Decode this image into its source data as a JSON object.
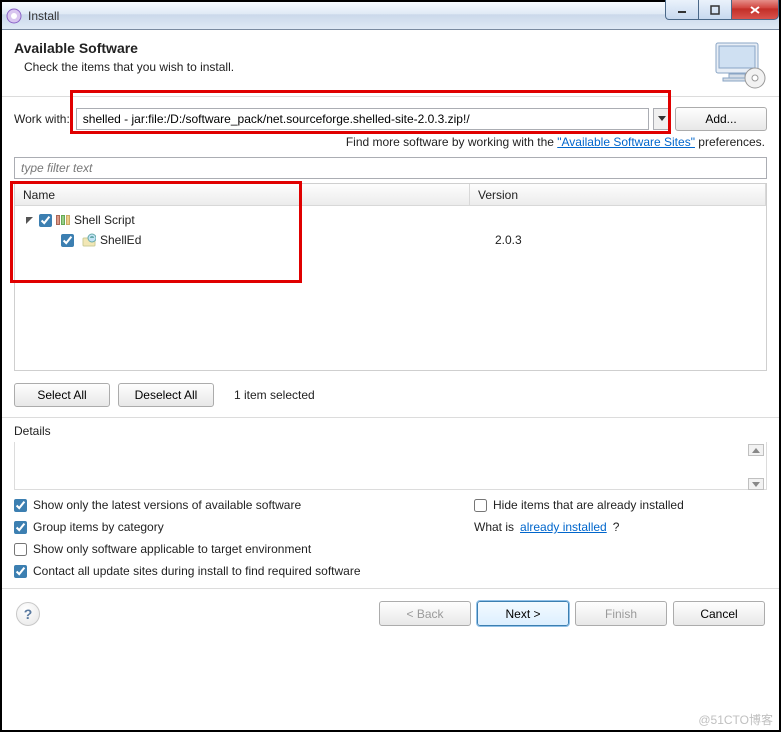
{
  "window": {
    "title": "Install"
  },
  "header": {
    "title": "Available Software",
    "subtitle": "Check the items that you wish to install."
  },
  "workwith": {
    "label": "Work with:",
    "value": "shelled - jar:file:/D:/software_pack/net.sourceforge.shelled-site-2.0.3.zip!/",
    "add_label": "Add...",
    "findmore_prefix": "Find more software by working with the ",
    "findmore_link": "\"Available Software Sites\"",
    "findmore_suffix": " preferences."
  },
  "filter": {
    "placeholder": "type filter text"
  },
  "tree": {
    "columns": {
      "name": "Name",
      "version": "Version"
    },
    "root": {
      "label": "Shell Script",
      "checked": true,
      "expanded": true
    },
    "child": {
      "label": "ShellEd",
      "checked": true,
      "version": "2.0.3"
    }
  },
  "selection": {
    "select_all": "Select All",
    "deselect_all": "Deselect All",
    "status": "1 item selected"
  },
  "details": {
    "label": "Details"
  },
  "options": {
    "latest": {
      "label": "Show only the latest versions of available software",
      "checked": true
    },
    "group": {
      "label": "Group items by category",
      "checked": true
    },
    "target_only": {
      "label": "Show only software applicable to target environment",
      "checked": false
    },
    "contact": {
      "label": "Contact all update sites during install to find required software",
      "checked": true
    },
    "hide_installed": {
      "label": "Hide items that are already installed",
      "checked": false
    },
    "whatis_prefix": "What is ",
    "whatis_link": "already installed",
    "whatis_suffix": "?"
  },
  "footer": {
    "back": "< Back",
    "next": "Next >",
    "finish": "Finish",
    "cancel": "Cancel"
  },
  "watermark": "@51CTO博客"
}
